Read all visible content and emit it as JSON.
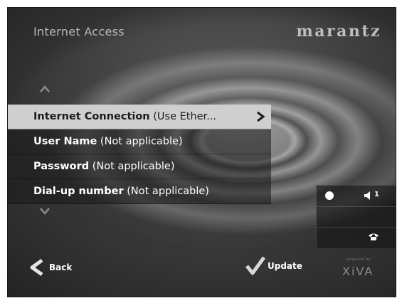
{
  "header": {
    "title": "Internet Access",
    "brand": "marantz"
  },
  "menu": {
    "items": [
      {
        "label": "Internet Connection",
        "note": "(Use Ether...",
        "selected": true,
        "has_arrow": true
      },
      {
        "label": "User Name",
        "note": "(Not applicable)",
        "selected": false,
        "has_arrow": false
      },
      {
        "label": "Password",
        "note": "(Not applicable)",
        "selected": false,
        "has_arrow": false
      },
      {
        "label": "Dial-up number",
        "note": "(Not applicable)",
        "selected": false,
        "has_arrow": false
      }
    ],
    "scroll_up_icon": "chevron-up-icon",
    "scroll_down_icon": "chevron-down-icon"
  },
  "status": {
    "indicator_icon": "status-dot-icon",
    "speaker_icon": "speaker-icon",
    "speaker_zone": "1",
    "phone_icon": "phone-icon"
  },
  "footer": {
    "back_label": "Back",
    "update_label": "Update",
    "powered_by": "powered by",
    "partner_logo": "XiVA"
  },
  "colors": {
    "selected_bg": "#cfcfcf",
    "menu_bg": "#1f1f1f",
    "text": "#ffffff",
    "title": "#b8b8b8"
  }
}
